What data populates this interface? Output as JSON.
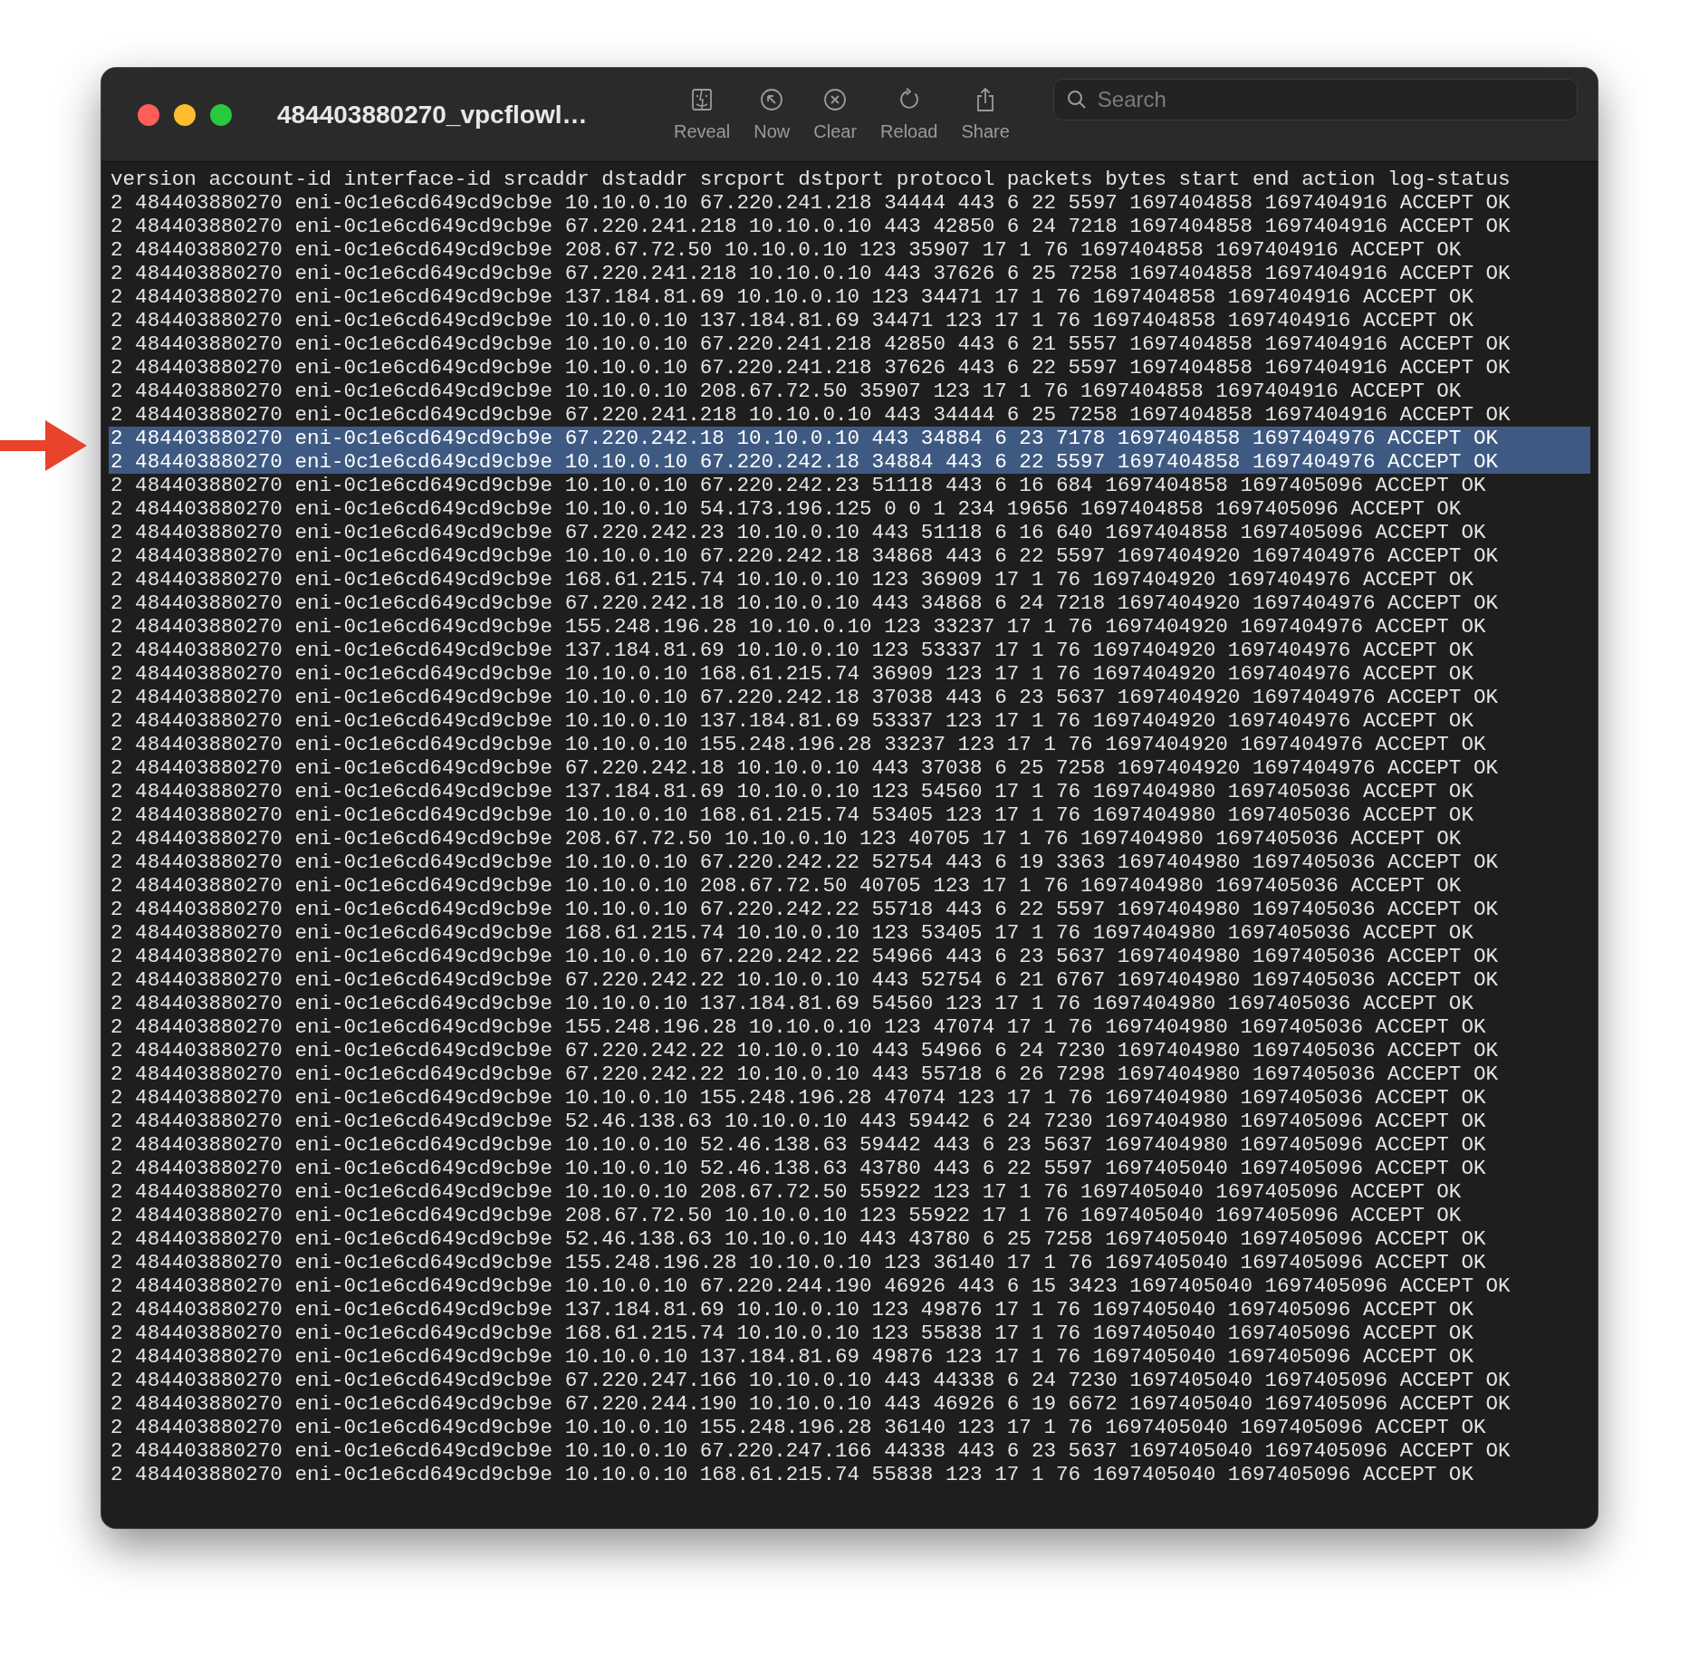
{
  "window": {
    "title": "484403880270_vpcflowl…"
  },
  "toolbar": {
    "buttons": [
      {
        "kind": "reveal",
        "label": "Reveal"
      },
      {
        "kind": "now",
        "label": "Now"
      },
      {
        "kind": "clear",
        "label": "Clear"
      },
      {
        "kind": "reload",
        "label": "Reload"
      },
      {
        "kind": "share",
        "label": "Share"
      }
    ]
  },
  "search": {
    "placeholder": "Search"
  },
  "log": {
    "header": "version account-id interface-id srcaddr dstaddr srcport dstport protocol packets bytes start end action log-status",
    "lines": [
      {
        "text": "2 484403880270 eni-0c1e6cd649cd9cb9e 10.10.0.10 67.220.241.218 34444 443 6 22 5597 1697404858 1697404916 ACCEPT OK",
        "selected": false
      },
      {
        "text": "2 484403880270 eni-0c1e6cd649cd9cb9e 67.220.241.218 10.10.0.10 443 42850 6 24 7218 1697404858 1697404916 ACCEPT OK",
        "selected": false
      },
      {
        "text": "2 484403880270 eni-0c1e6cd649cd9cb9e 208.67.72.50 10.10.0.10 123 35907 17 1 76 1697404858 1697404916 ACCEPT OK",
        "selected": false
      },
      {
        "text": "2 484403880270 eni-0c1e6cd649cd9cb9e 67.220.241.218 10.10.0.10 443 37626 6 25 7258 1697404858 1697404916 ACCEPT OK",
        "selected": false
      },
      {
        "text": "2 484403880270 eni-0c1e6cd649cd9cb9e 137.184.81.69 10.10.0.10 123 34471 17 1 76 1697404858 1697404916 ACCEPT OK",
        "selected": false
      },
      {
        "text": "2 484403880270 eni-0c1e6cd649cd9cb9e 10.10.0.10 137.184.81.69 34471 123 17 1 76 1697404858 1697404916 ACCEPT OK",
        "selected": false
      },
      {
        "text": "2 484403880270 eni-0c1e6cd649cd9cb9e 10.10.0.10 67.220.241.218 42850 443 6 21 5557 1697404858 1697404916 ACCEPT OK",
        "selected": false
      },
      {
        "text": "2 484403880270 eni-0c1e6cd649cd9cb9e 10.10.0.10 67.220.241.218 37626 443 6 22 5597 1697404858 1697404916 ACCEPT OK",
        "selected": false
      },
      {
        "text": "2 484403880270 eni-0c1e6cd649cd9cb9e 10.10.0.10 208.67.72.50 35907 123 17 1 76 1697404858 1697404916 ACCEPT OK",
        "selected": false
      },
      {
        "text": "2 484403880270 eni-0c1e6cd649cd9cb9e 67.220.241.218 10.10.0.10 443 34444 6 25 7258 1697404858 1697404916 ACCEPT OK",
        "selected": false
      },
      {
        "text": "2 484403880270 eni-0c1e6cd649cd9cb9e 67.220.242.18 10.10.0.10 443 34884 6 23 7178 1697404858 1697404976 ACCEPT OK",
        "selected": true
      },
      {
        "text": "2 484403880270 eni-0c1e6cd649cd9cb9e 10.10.0.10 67.220.242.18 34884 443 6 22 5597 1697404858 1697404976 ACCEPT OK",
        "selected": true
      },
      {
        "text": "2 484403880270 eni-0c1e6cd649cd9cb9e 10.10.0.10 67.220.242.23 51118 443 6 16 684 1697404858 1697405096 ACCEPT OK",
        "selected": false
      },
      {
        "text": "2 484403880270 eni-0c1e6cd649cd9cb9e 10.10.0.10 54.173.196.125 0 0 1 234 19656 1697404858 1697405096 ACCEPT OK",
        "selected": false
      },
      {
        "text": "2 484403880270 eni-0c1e6cd649cd9cb9e 67.220.242.23 10.10.0.10 443 51118 6 16 640 1697404858 1697405096 ACCEPT OK",
        "selected": false
      },
      {
        "text": "2 484403880270 eni-0c1e6cd649cd9cb9e 10.10.0.10 67.220.242.18 34868 443 6 22 5597 1697404920 1697404976 ACCEPT OK",
        "selected": false
      },
      {
        "text": "2 484403880270 eni-0c1e6cd649cd9cb9e 168.61.215.74 10.10.0.10 123 36909 17 1 76 1697404920 1697404976 ACCEPT OK",
        "selected": false
      },
      {
        "text": "2 484403880270 eni-0c1e6cd649cd9cb9e 67.220.242.18 10.10.0.10 443 34868 6 24 7218 1697404920 1697404976 ACCEPT OK",
        "selected": false
      },
      {
        "text": "2 484403880270 eni-0c1e6cd649cd9cb9e 155.248.196.28 10.10.0.10 123 33237 17 1 76 1697404920 1697404976 ACCEPT OK",
        "selected": false
      },
      {
        "text": "2 484403880270 eni-0c1e6cd649cd9cb9e 137.184.81.69 10.10.0.10 123 53337 17 1 76 1697404920 1697404976 ACCEPT OK",
        "selected": false
      },
      {
        "text": "2 484403880270 eni-0c1e6cd649cd9cb9e 10.10.0.10 168.61.215.74 36909 123 17 1 76 1697404920 1697404976 ACCEPT OK",
        "selected": false
      },
      {
        "text": "2 484403880270 eni-0c1e6cd649cd9cb9e 10.10.0.10 67.220.242.18 37038 443 6 23 5637 1697404920 1697404976 ACCEPT OK",
        "selected": false
      },
      {
        "text": "2 484403880270 eni-0c1e6cd649cd9cb9e 10.10.0.10 137.184.81.69 53337 123 17 1 76 1697404920 1697404976 ACCEPT OK",
        "selected": false
      },
      {
        "text": "2 484403880270 eni-0c1e6cd649cd9cb9e 10.10.0.10 155.248.196.28 33237 123 17 1 76 1697404920 1697404976 ACCEPT OK",
        "selected": false
      },
      {
        "text": "2 484403880270 eni-0c1e6cd649cd9cb9e 67.220.242.18 10.10.0.10 443 37038 6 25 7258 1697404920 1697404976 ACCEPT OK",
        "selected": false
      },
      {
        "text": "2 484403880270 eni-0c1e6cd649cd9cb9e 137.184.81.69 10.10.0.10 123 54560 17 1 76 1697404980 1697405036 ACCEPT OK",
        "selected": false
      },
      {
        "text": "2 484403880270 eni-0c1e6cd649cd9cb9e 10.10.0.10 168.61.215.74 53405 123 17 1 76 1697404980 1697405036 ACCEPT OK",
        "selected": false
      },
      {
        "text": "2 484403880270 eni-0c1e6cd649cd9cb9e 208.67.72.50 10.10.0.10 123 40705 17 1 76 1697404980 1697405036 ACCEPT OK",
        "selected": false
      },
      {
        "text": "2 484403880270 eni-0c1e6cd649cd9cb9e 10.10.0.10 67.220.242.22 52754 443 6 19 3363 1697404980 1697405036 ACCEPT OK",
        "selected": false
      },
      {
        "text": "2 484403880270 eni-0c1e6cd649cd9cb9e 10.10.0.10 208.67.72.50 40705 123 17 1 76 1697404980 1697405036 ACCEPT OK",
        "selected": false
      },
      {
        "text": "2 484403880270 eni-0c1e6cd649cd9cb9e 10.10.0.10 67.220.242.22 55718 443 6 22 5597 1697404980 1697405036 ACCEPT OK",
        "selected": false
      },
      {
        "text": "2 484403880270 eni-0c1e6cd649cd9cb9e 168.61.215.74 10.10.0.10 123 53405 17 1 76 1697404980 1697405036 ACCEPT OK",
        "selected": false
      },
      {
        "text": "2 484403880270 eni-0c1e6cd649cd9cb9e 10.10.0.10 67.220.242.22 54966 443 6 23 5637 1697404980 1697405036 ACCEPT OK",
        "selected": false
      },
      {
        "text": "2 484403880270 eni-0c1e6cd649cd9cb9e 67.220.242.22 10.10.0.10 443 52754 6 21 6767 1697404980 1697405036 ACCEPT OK",
        "selected": false
      },
      {
        "text": "2 484403880270 eni-0c1e6cd649cd9cb9e 10.10.0.10 137.184.81.69 54560 123 17 1 76 1697404980 1697405036 ACCEPT OK",
        "selected": false
      },
      {
        "text": "2 484403880270 eni-0c1e6cd649cd9cb9e 155.248.196.28 10.10.0.10 123 47074 17 1 76 1697404980 1697405036 ACCEPT OK",
        "selected": false
      },
      {
        "text": "2 484403880270 eni-0c1e6cd649cd9cb9e 67.220.242.22 10.10.0.10 443 54966 6 24 7230 1697404980 1697405036 ACCEPT OK",
        "selected": false
      },
      {
        "text": "2 484403880270 eni-0c1e6cd649cd9cb9e 67.220.242.22 10.10.0.10 443 55718 6 26 7298 1697404980 1697405036 ACCEPT OK",
        "selected": false
      },
      {
        "text": "2 484403880270 eni-0c1e6cd649cd9cb9e 10.10.0.10 155.248.196.28 47074 123 17 1 76 1697404980 1697405036 ACCEPT OK",
        "selected": false
      },
      {
        "text": "2 484403880270 eni-0c1e6cd649cd9cb9e 52.46.138.63 10.10.0.10 443 59442 6 24 7230 1697404980 1697405096 ACCEPT OK",
        "selected": false
      },
      {
        "text": "2 484403880270 eni-0c1e6cd649cd9cb9e 10.10.0.10 52.46.138.63 59442 443 6 23 5637 1697404980 1697405096 ACCEPT OK",
        "selected": false
      },
      {
        "text": "2 484403880270 eni-0c1e6cd649cd9cb9e 10.10.0.10 52.46.138.63 43780 443 6 22 5597 1697405040 1697405096 ACCEPT OK",
        "selected": false
      },
      {
        "text": "2 484403880270 eni-0c1e6cd649cd9cb9e 10.10.0.10 208.67.72.50 55922 123 17 1 76 1697405040 1697405096 ACCEPT OK",
        "selected": false
      },
      {
        "text": "2 484403880270 eni-0c1e6cd649cd9cb9e 208.67.72.50 10.10.0.10 123 55922 17 1 76 1697405040 1697405096 ACCEPT OK",
        "selected": false
      },
      {
        "text": "2 484403880270 eni-0c1e6cd649cd9cb9e 52.46.138.63 10.10.0.10 443 43780 6 25 7258 1697405040 1697405096 ACCEPT OK",
        "selected": false
      },
      {
        "text": "2 484403880270 eni-0c1e6cd649cd9cb9e 155.248.196.28 10.10.0.10 123 36140 17 1 76 1697405040 1697405096 ACCEPT OK",
        "selected": false
      },
      {
        "text": "2 484403880270 eni-0c1e6cd649cd9cb9e 10.10.0.10 67.220.244.190 46926 443 6 15 3423 1697405040 1697405096 ACCEPT OK",
        "selected": false
      },
      {
        "text": "2 484403880270 eni-0c1e6cd649cd9cb9e 137.184.81.69 10.10.0.10 123 49876 17 1 76 1697405040 1697405096 ACCEPT OK",
        "selected": false
      },
      {
        "text": "2 484403880270 eni-0c1e6cd649cd9cb9e 168.61.215.74 10.10.0.10 123 55838 17 1 76 1697405040 1697405096 ACCEPT OK",
        "selected": false
      },
      {
        "text": "2 484403880270 eni-0c1e6cd649cd9cb9e 10.10.0.10 137.184.81.69 49876 123 17 1 76 1697405040 1697405096 ACCEPT OK",
        "selected": false
      },
      {
        "text": "2 484403880270 eni-0c1e6cd649cd9cb9e 67.220.247.166 10.10.0.10 443 44338 6 24 7230 1697405040 1697405096 ACCEPT OK",
        "selected": false
      },
      {
        "text": "2 484403880270 eni-0c1e6cd649cd9cb9e 67.220.244.190 10.10.0.10 443 46926 6 19 6672 1697405040 1697405096 ACCEPT OK",
        "selected": false
      },
      {
        "text": "2 484403880270 eni-0c1e6cd649cd9cb9e 10.10.0.10 155.248.196.28 36140 123 17 1 76 1697405040 1697405096 ACCEPT OK",
        "selected": false
      },
      {
        "text": "2 484403880270 eni-0c1e6cd649cd9cb9e 10.10.0.10 67.220.247.166 44338 443 6 23 5637 1697405040 1697405096 ACCEPT OK",
        "selected": false
      },
      {
        "text": "2 484403880270 eni-0c1e6cd649cd9cb9e 10.10.0.10 168.61.215.74 55838 123 17 1 76 1697405040 1697405096 ACCEPT OK",
        "selected": false
      }
    ]
  }
}
